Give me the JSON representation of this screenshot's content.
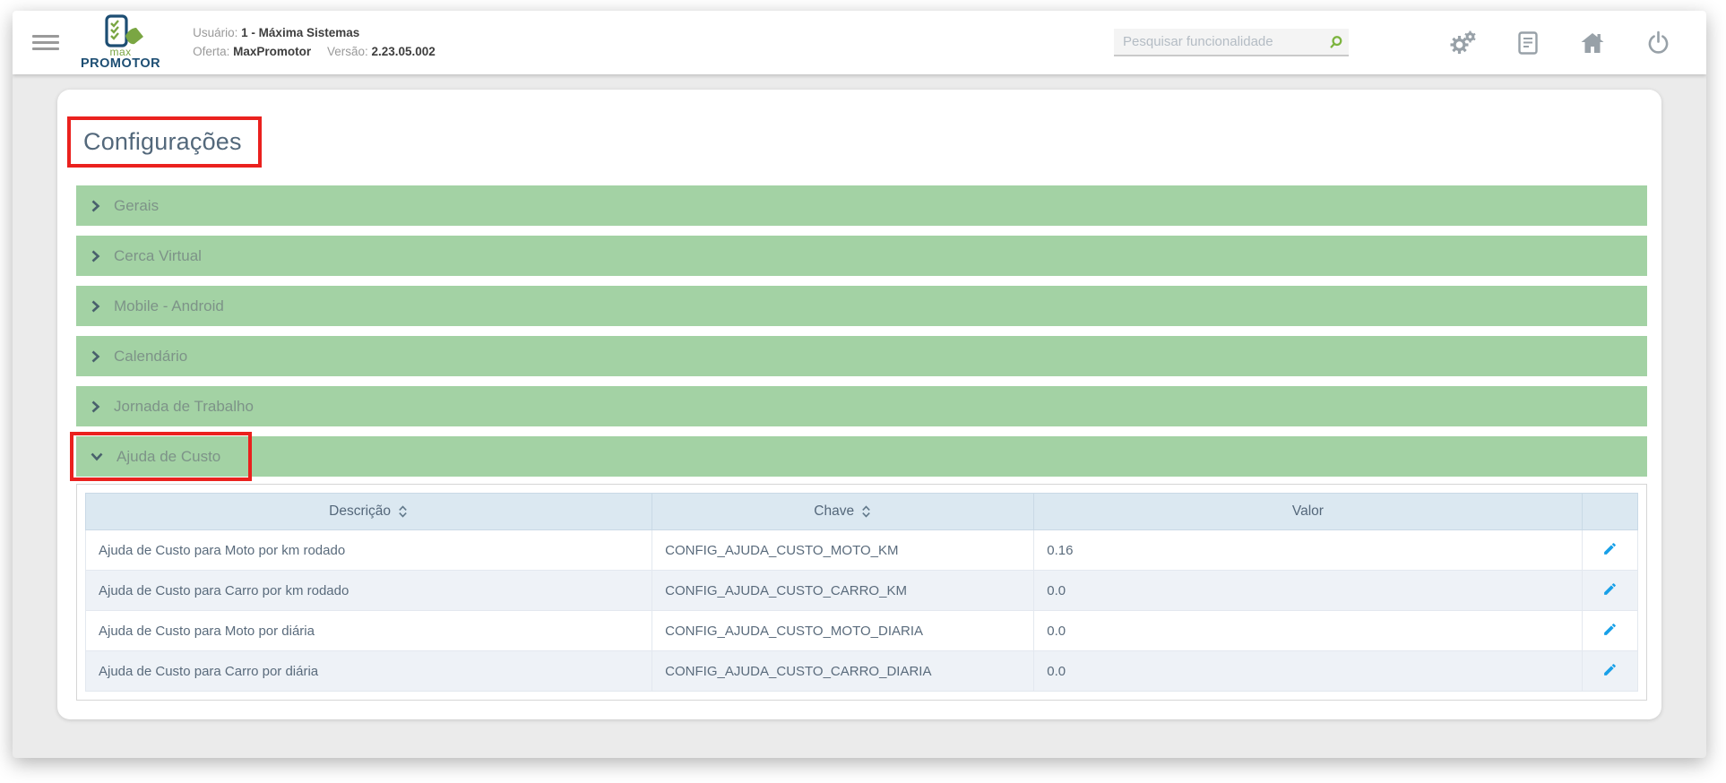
{
  "topbar": {
    "logo": {
      "line1": "max",
      "line2": "PROMOTOR"
    },
    "user_label": "Usuário:",
    "user_value": "1 - Máxima Sistemas",
    "offer_label": "Oferta:",
    "offer_value": "MaxPromotor",
    "version_label": "Versão:",
    "version_value": "2.23.05.002",
    "search": {
      "placeholder": "Pesquisar funcionalidade",
      "icon": "magnifier"
    },
    "action_icons": [
      {
        "name": "settings-gears"
      },
      {
        "name": "document-list"
      },
      {
        "name": "home"
      },
      {
        "name": "power"
      }
    ]
  },
  "page": {
    "title": "Configurações"
  },
  "accordion": {
    "items": [
      {
        "label": "Gerais",
        "state": "collapsed"
      },
      {
        "label": "Cerca Virtual",
        "state": "collapsed"
      },
      {
        "label": "Mobile - Android",
        "state": "collapsed"
      },
      {
        "label": "Calendário",
        "state": "collapsed"
      },
      {
        "label": "Jornada de Trabalho",
        "state": "collapsed"
      },
      {
        "label": "Ajuda de Custo",
        "state": "expanded"
      }
    ]
  },
  "table": {
    "headers": [
      {
        "label": "Descrição",
        "sortable": true
      },
      {
        "label": "Chave",
        "sortable": true
      },
      {
        "label": "Valor",
        "sortable": false
      },
      {
        "label": "",
        "sortable": false
      }
    ],
    "rows": [
      {
        "descricao": "Ajuda de Custo para Moto por km rodado",
        "chave": "CONFIG_AJUDA_CUSTO_MOTO_KM",
        "valor": "0.16",
        "action_icon": "pencil-edit"
      },
      {
        "descricao": "Ajuda de Custo para Carro por km rodado",
        "chave": "CONFIG_AJUDA_CUSTO_CARRO_KM",
        "valor": "0.0",
        "action_icon": "pencil-edit"
      },
      {
        "descricao": "Ajuda de Custo para Moto por diária",
        "chave": "CONFIG_AJUDA_CUSTO_MOTO_DIARIA",
        "valor": "0.0",
        "action_icon": "pencil-edit"
      },
      {
        "descricao": "Ajuda de Custo para Carro por diária",
        "chave": "CONFIG_AJUDA_CUSTO_CARRO_DIARIA",
        "valor": "0.0",
        "action_icon": "pencil-edit"
      }
    ]
  },
  "annotations": {
    "color": "#ea211e",
    "highlighted": [
      "Configurações title",
      "Ajuda de Custo header"
    ]
  },
  "colors": {
    "accordion_green": "#a3d2a4",
    "table_header_blue": "#dbe8f1",
    "row_stripe": "#eef2f7",
    "edit_icon_blue": "#18a0e8",
    "logo_navy": "#1d4e73",
    "logo_green": "#7aa643",
    "page_bg": "#ebebeb"
  }
}
